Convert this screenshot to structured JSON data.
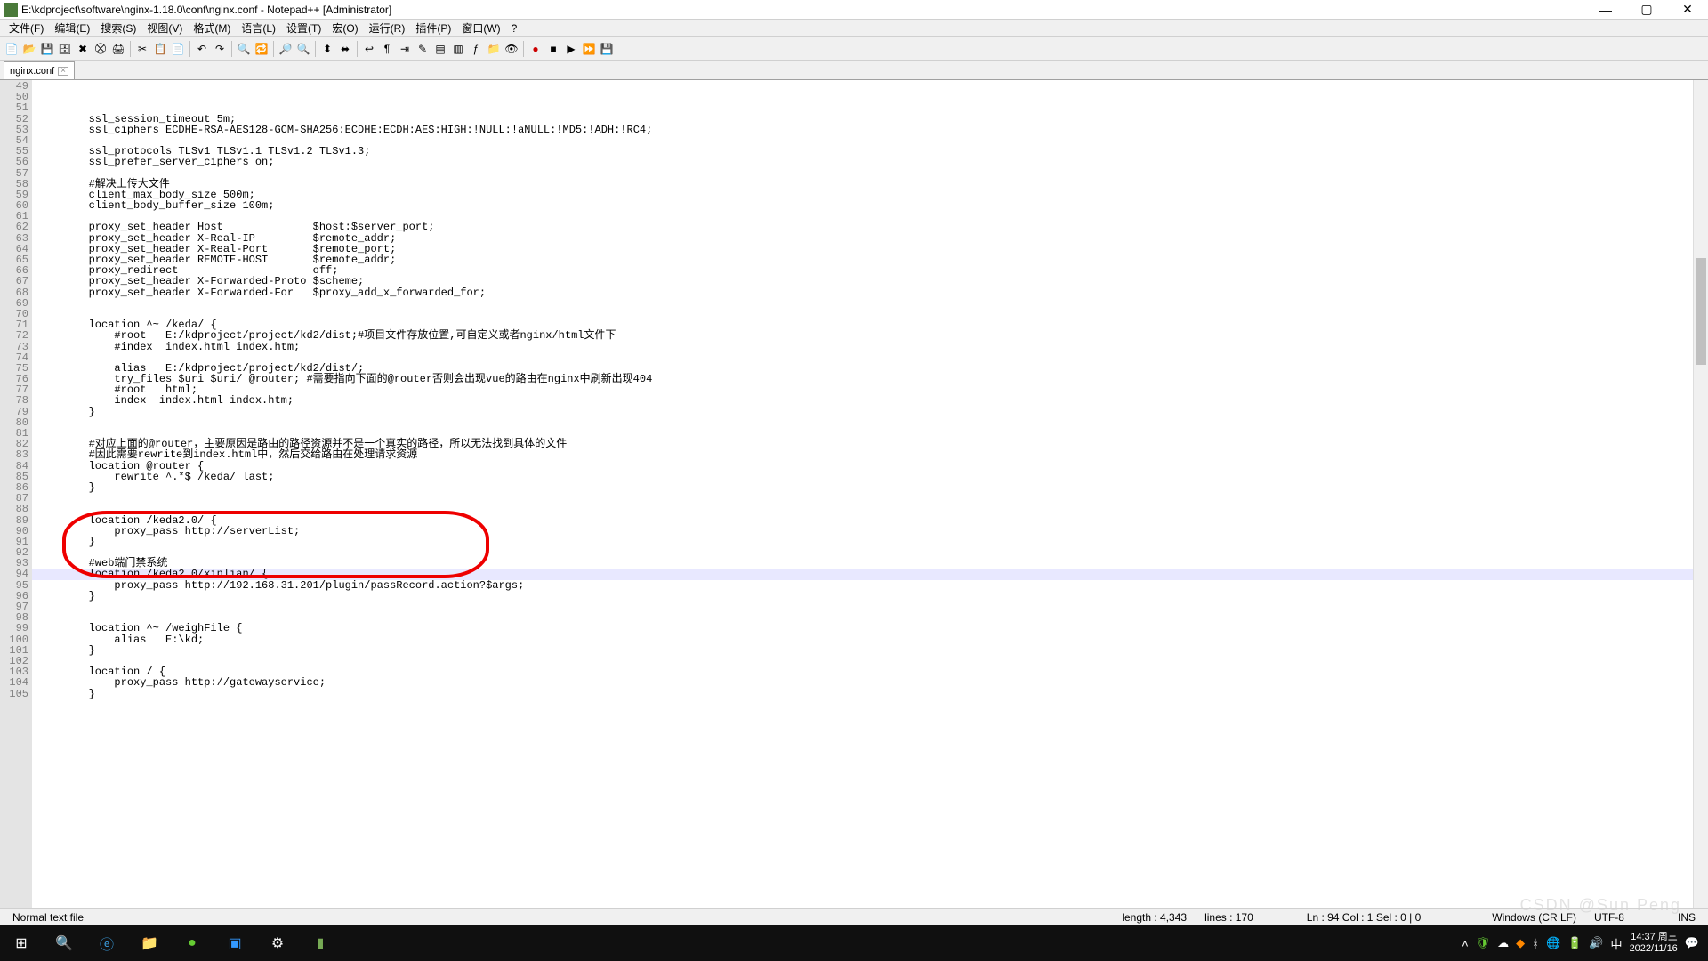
{
  "window": {
    "title": "E:\\kdproject\\software\\nginx-1.18.0\\conf\\nginx.conf - Notepad++ [Administrator]"
  },
  "menu": {
    "items": [
      "文件(F)",
      "编辑(E)",
      "搜索(S)",
      "视图(V)",
      "格式(M)",
      "语言(L)",
      "设置(T)",
      "宏(O)",
      "运行(R)",
      "插件(P)",
      "窗口(W)",
      "?"
    ]
  },
  "tab": {
    "name": "nginx.conf"
  },
  "editor": {
    "first_line": 49,
    "cursor_line": 94,
    "lines": [
      "        ssl_session_timeout 5m;",
      "        ssl_ciphers ECDHE-RSA-AES128-GCM-SHA256:ECDHE:ECDH:AES:HIGH:!NULL:!aNULL:!MD5:!ADH:!RC4;",
      "",
      "        ssl_protocols TLSv1 TLSv1.1 TLSv1.2 TLSv1.3;",
      "        ssl_prefer_server_ciphers on;",
      "",
      "        #解决上传大文件",
      "        client_max_body_size 500m;",
      "        client_body_buffer_size 100m;",
      "",
      "        proxy_set_header Host              $host:$server_port;",
      "        proxy_set_header X-Real-IP         $remote_addr;",
      "        proxy_set_header X-Real-Port       $remote_port;",
      "        proxy_set_header REMOTE-HOST       $remote_addr;",
      "        proxy_redirect                     off;",
      "        proxy_set_header X-Forwarded-Proto $scheme;",
      "        proxy_set_header X-Forwarded-For   $proxy_add_x_forwarded_for;",
      "",
      "",
      "        location ^~ /keda/ {",
      "            #root   E:/kdproject/project/kd2/dist;#项目文件存放位置,可自定义或者nginx/html文件下",
      "            #index  index.html index.htm;",
      "",
      "            alias   E:/kdproject/project/kd2/dist/;",
      "            try_files $uri $uri/ @router; #需要指向下面的@router否则会出现vue的路由在nginx中刷新出现404",
      "            #root   html;",
      "            index  index.html index.htm;",
      "        }",
      "",
      "",
      "        #对应上面的@router，主要原因是路由的路径资源并不是一个真实的路径，所以无法找到具体的文件",
      "        #因此需要rewrite到index.html中，然后交给路由在处理请求资源",
      "        location @router {",
      "            rewrite ^.*$ /keda/ last;",
      "        }",
      "",
      "",
      "        location /keda2.0/ {",
      "            proxy_pass http://serverList;",
      "        }",
      "",
      "        #web端门禁系统",
      "        location /keda2.0/xinlian/ {",
      "            proxy_pass http://192.168.31.201/plugin/passRecord.action?$args;",
      "        }",
      "",
      "",
      "        location ^~ /weighFile {",
      "            alias   E:\\kd;",
      "        }",
      "",
      "        location / {",
      "            proxy_pass http://gatewayservice;",
      "        }",
      "",
      "",
      ""
    ]
  },
  "status": {
    "filetype": "Normal text file",
    "length": "length : 4,343",
    "lines": "lines : 170",
    "position": "Ln : 94   Col : 1   Sel : 0 | 0",
    "eol": "Windows (CR LF)",
    "encoding": "UTF-8",
    "mode": "INS"
  },
  "taskbar": {
    "time": "14:37 周三",
    "date": "2022/11/16",
    "ime": "中"
  },
  "watermark": "CSDN @Sun Peng"
}
